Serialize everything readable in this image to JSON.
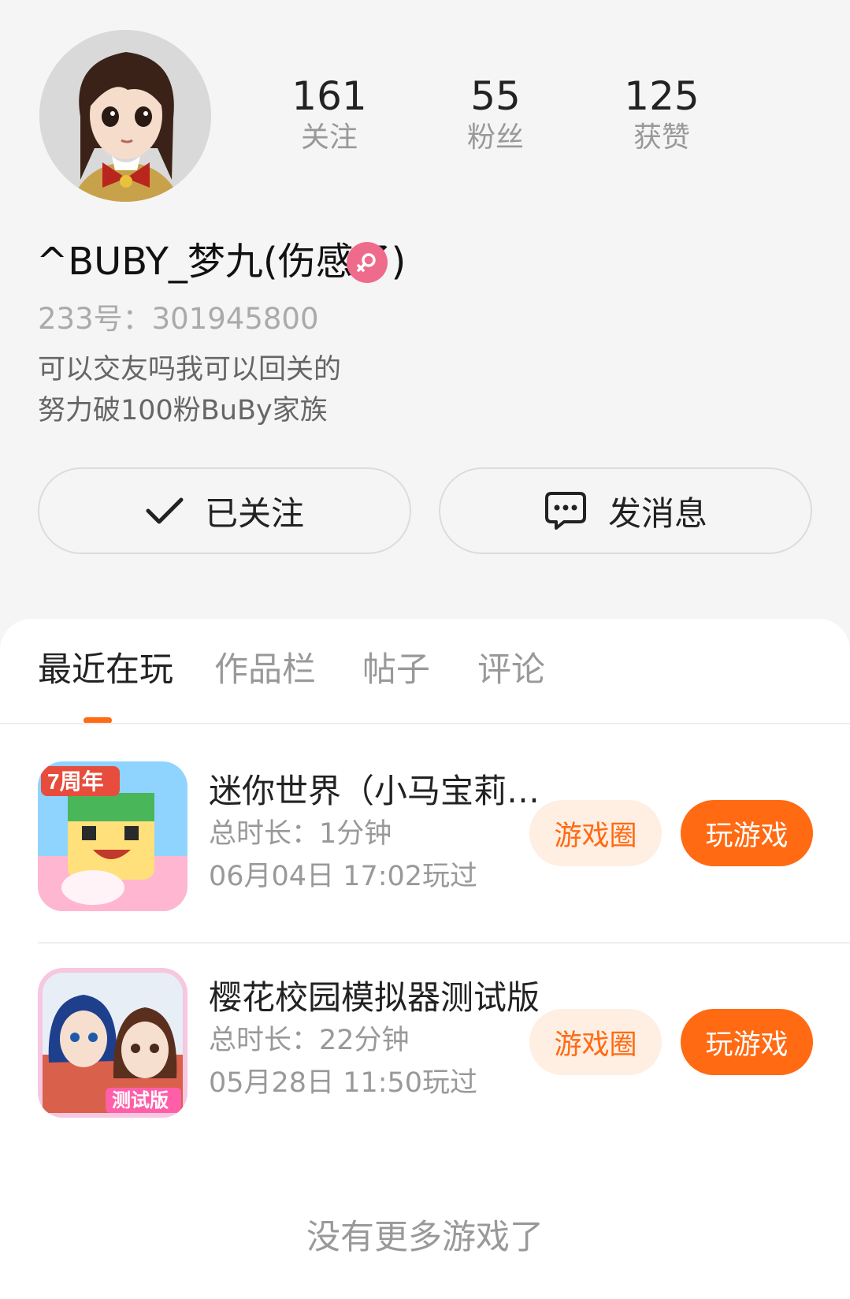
{
  "profile": {
    "stats": [
      {
        "value": "161",
        "label": "关注"
      },
      {
        "value": "55",
        "label": "粉丝"
      },
      {
        "value": "125",
        "label": "获赞"
      }
    ],
    "nickname": "^BUBY_梦九(伤感了)",
    "gender_icon": "female-icon",
    "account_id": "233号：301945800",
    "bio": [
      "可以交友吗我可以回关的",
      "努力破100粉BuBy家族"
    ]
  },
  "actions": {
    "follow_label": "已关注",
    "message_label": "发消息"
  },
  "tabs": [
    {
      "label": "最近在玩",
      "active": true
    },
    {
      "label": "作品栏",
      "active": false
    },
    {
      "label": "帖子",
      "active": false
    },
    {
      "label": "评论",
      "active": false
    }
  ],
  "games": [
    {
      "title": "迷你世界（小马宝莉…",
      "duration": "总时长：1分钟",
      "last_played": "06月04日 17:02玩过",
      "icon_badge": "7周年",
      "circle_label": "游戏圈",
      "play_label": "玩游戏"
    },
    {
      "title": "樱花校园模拟器测试版",
      "duration": "总时长：22分钟",
      "last_played": "05月28日 11:50玩过",
      "icon_badge": "测试版",
      "circle_label": "游戏圈",
      "play_label": "玩游戏"
    }
  ],
  "footer": {
    "no_more": "没有更多游戏了"
  },
  "colors": {
    "accent": "#ff6a13",
    "accent_light": "#ffeee2",
    "gender": "#ee6b8c"
  }
}
